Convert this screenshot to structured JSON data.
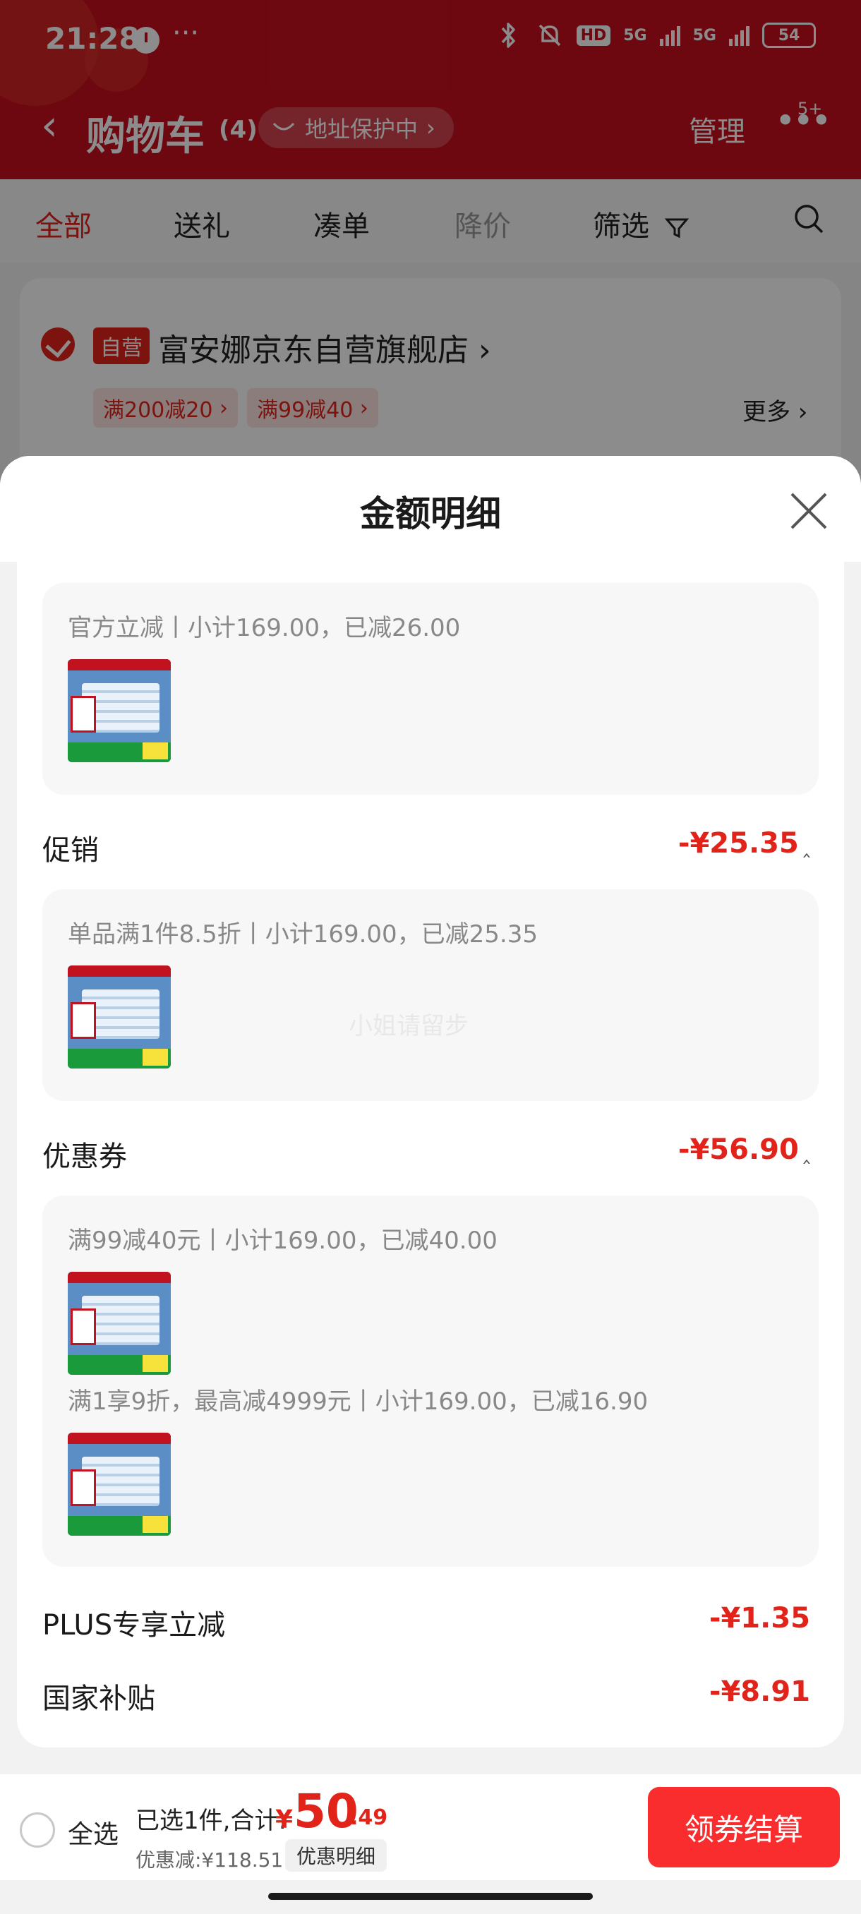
{
  "status_bar": {
    "time": "21:28",
    "dots": "···",
    "hd": "HD",
    "net1": "5G",
    "net2": "5G",
    "battery": "54"
  },
  "navbar": {
    "title": "购物车",
    "count": "(4)",
    "address_pill": "地址保护中",
    "manage": "管理",
    "badge": "5+"
  },
  "tabs": [
    {
      "label": "全部",
      "state": "active"
    },
    {
      "label": "送礼",
      "state": "normal"
    },
    {
      "label": "凑单",
      "state": "normal"
    },
    {
      "label": "降价",
      "state": "disabled"
    },
    {
      "label": "筛选",
      "state": "normal"
    }
  ],
  "store": {
    "self_tag": "自营",
    "name": "富安娜京东自营旗舰店",
    "promos": [
      "满200减20",
      "满99减40"
    ],
    "more": "更多"
  },
  "sheet": {
    "title": "金额明细",
    "groups": {
      "official": {
        "line": "官方立减丨小计169.00，已减26.00"
      },
      "promotion": {
        "label": "促销",
        "amount": "-¥25.35",
        "line": "单品满1件8.5折丨小计169.00，已减25.35"
      },
      "coupon": {
        "label": "优惠券",
        "amount": "-¥56.90",
        "line1": "满99减40元丨小计169.00，已减40.00",
        "line2": "满1享9折，最高减4999元丨小计169.00，已减16.90"
      },
      "plus": {
        "label": "PLUS专享立减",
        "amount": "-¥1.35"
      },
      "subsidy": {
        "label": "国家补贴",
        "amount": "-¥8.91"
      }
    },
    "watermark": "小姐请留步"
  },
  "bottom_bar": {
    "select_all": "全选",
    "selected_info": "已选1件,合计:",
    "currency": "¥",
    "price_int": "50",
    "price_dec": ".49",
    "discount": "优惠减:¥118.51",
    "detail_button": "优惠明细",
    "checkout_button": "领券结算"
  },
  "colors": {
    "brand_red": "#c7101e",
    "accent_red": "#e2231a",
    "checkout_red": "#f92c2e"
  }
}
